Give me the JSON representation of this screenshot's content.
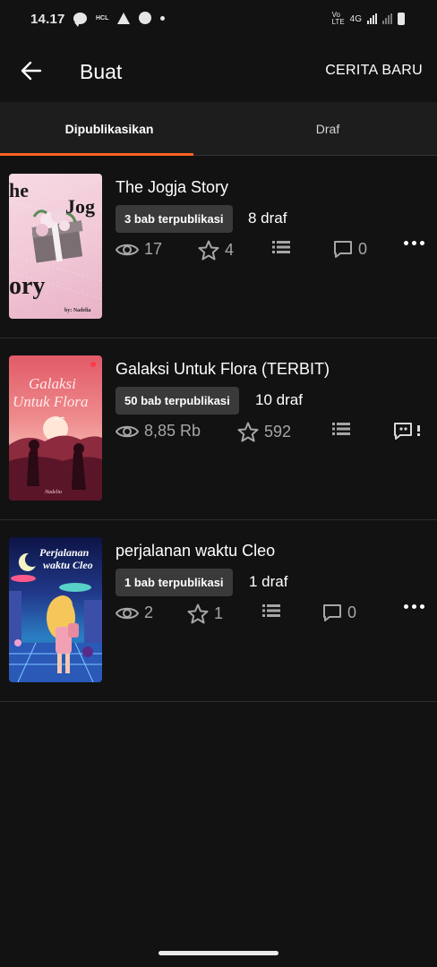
{
  "status_bar": {
    "time": "14.17",
    "small_label": "HCL",
    "network": "4G"
  },
  "app_bar": {
    "title": "Buat",
    "new_story_label": "CERITA BARU",
    "back_icon": "arrow-left-icon"
  },
  "tabs": [
    {
      "label": "Dipublikasikan",
      "active": true
    },
    {
      "label": "Draf",
      "active": false
    }
  ],
  "colors": {
    "accent": "#ff6122",
    "background": "#121212",
    "tab_bar": "#1d1d1d",
    "badge": "#3a3a3a",
    "stat_text": "#a6a6a6"
  },
  "stories": [
    {
      "title": "The Jogja Story",
      "published_label": "3 bab terpublikasi",
      "draft_label": "8 draf",
      "views": "17",
      "votes": "4",
      "comments": "0",
      "cover_text": {
        "top": "he",
        "mid": "Jog",
        "bottom": "ory",
        "author": "by: Nadelia"
      }
    },
    {
      "title": "Galaksi Untuk Flora  (TERBIT)",
      "published_label": "50 bab terpublikasi",
      "draft_label": "10 draf",
      "views": "8,85 Rb",
      "votes": "592",
      "comments": "",
      "cover_text": {
        "line1": "Galaksi",
        "line2": "Untuk Flora",
        "author": "Nadelia"
      }
    },
    {
      "title": "perjalanan waktu Cleo",
      "published_label": "1 bab terpublikasi",
      "draft_label": "1 draf",
      "views": "2",
      "votes": "1",
      "comments": "0",
      "cover_text": {
        "line1": "Perjalanan",
        "line2": "waktu Cleo"
      }
    }
  ]
}
